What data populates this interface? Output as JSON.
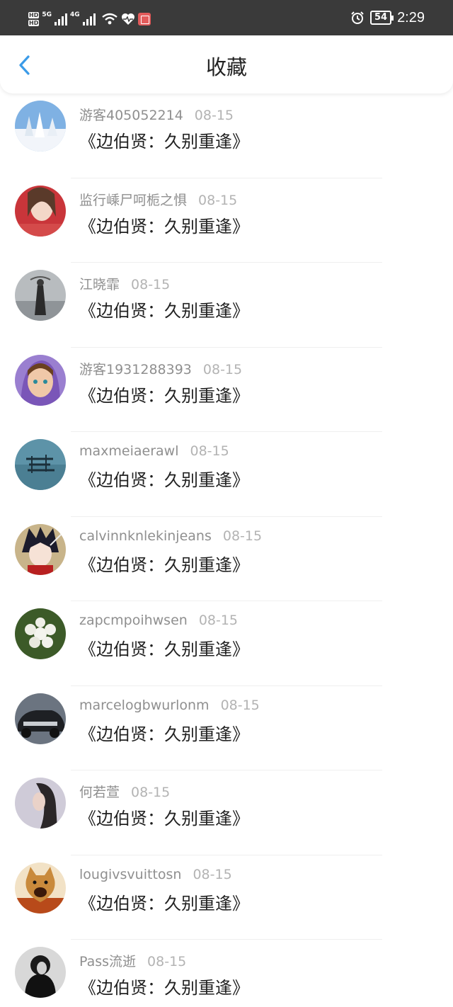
{
  "status_bar": {
    "hd1": "HD",
    "hd2": "HD",
    "net1": "5G",
    "net2": "4G",
    "battery": "54",
    "time": "2:29"
  },
  "header": {
    "title": "收藏"
  },
  "items": [
    {
      "user": "游客405052214",
      "date": "08-15",
      "book": "《边伯贤：久别重逢》"
    },
    {
      "user": "监行嵊尸呵栀之惧",
      "date": "08-15",
      "book": "《边伯贤：久别重逢》"
    },
    {
      "user": "江晓霏",
      "date": "08-15",
      "book": "《边伯贤：久别重逢》"
    },
    {
      "user": "游客1931288393",
      "date": "08-15",
      "book": "《边伯贤：久别重逢》"
    },
    {
      "user": "maxmeiaerawl",
      "date": "08-15",
      "book": "《边伯贤：久别重逢》"
    },
    {
      "user": "calvinnknlekinjeans",
      "date": "08-15",
      "book": "《边伯贤：久别重逢》"
    },
    {
      "user": "zapcmpoihwsen",
      "date": "08-15",
      "book": "《边伯贤：久别重逢》"
    },
    {
      "user": "marcelogbwurlonm",
      "date": "08-15",
      "book": "《边伯贤：久别重逢》"
    },
    {
      "user": "何若萱",
      "date": "08-15",
      "book": "《边伯贤：久别重逢》"
    },
    {
      "user": "lougivsvuittosn",
      "date": "08-15",
      "book": "《边伯贤：久别重逢》"
    },
    {
      "user": "Pass流逝",
      "date": "08-15",
      "book": "《边伯贤：久别重逢》"
    }
  ],
  "colors": {
    "accent": "#3b9be8",
    "statusbar_bg": "#3a3a3a",
    "username": "#8f8f8f",
    "date": "#b3b3b3"
  }
}
